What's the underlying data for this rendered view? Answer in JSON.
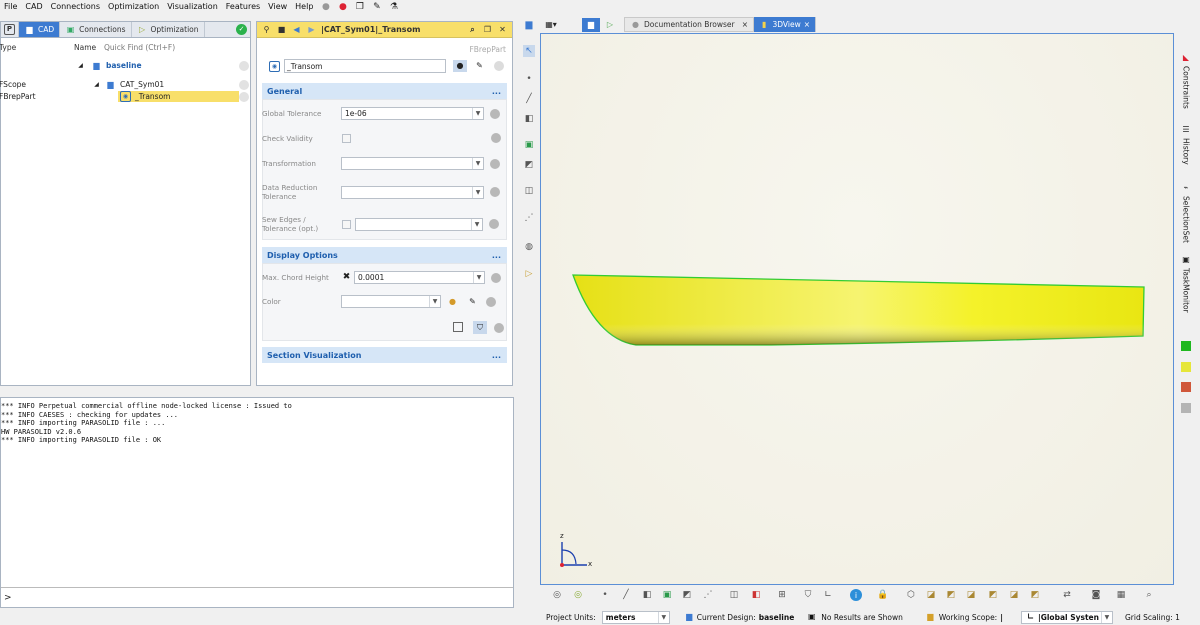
{
  "menubar": {
    "items": [
      "File",
      "CAD",
      "Connections",
      "Optimization",
      "Visualization",
      "Features",
      "View",
      "Help"
    ]
  },
  "left_tabs": {
    "p_label": "P",
    "cad": "CAD",
    "connections": "Connections",
    "optimization": "Optimization"
  },
  "tree": {
    "col_type": "Type",
    "col_name": "Name",
    "quick_find_placeholder": "Quick Find (Ctrl+F)",
    "rows": [
      {
        "type": "",
        "name": "baseline"
      },
      {
        "type": "FScope",
        "name": "CAT_Sym01"
      },
      {
        "type": "FBrepPart",
        "name": "_Transom"
      }
    ]
  },
  "props": {
    "title": "|CAT_Sym01|_Transom",
    "object_type": "FBrepPart",
    "name_value": "_Transom",
    "sections": {
      "general": "General",
      "display": "Display Options",
      "section_vis": "Section Visualization"
    },
    "collapse_glyph": "...",
    "labels": {
      "global_tolerance": "Global Tolerance",
      "check_validity": "Check Validity",
      "transformation": "Transformation",
      "data_reduction_1": "Data Reduction",
      "data_reduction_2": "Tolerance",
      "sew_edges_1": "Sew Edges /",
      "sew_edges_2": "Tolerance (opt.)",
      "max_chord": "Max. Chord Height",
      "color": "Color"
    },
    "values": {
      "global_tolerance": "1e-06",
      "transformation": "",
      "data_reduction": "",
      "sew_edges": "",
      "max_chord": "0.0001",
      "color": ""
    }
  },
  "console": {
    "lines": [
      "*** INFO Perpetual commercial offline node-locked license : Issued to",
      "*** INFO CAESES : checking for updates ...",
      "*** INFO importing PARASOLID file : ...",
      "HW PARASOLID v2.0.6",
      "*** INFO importing PARASOLID file : OK"
    ],
    "prompt": ">"
  },
  "viewer_tabs": {
    "doc_browser": "Documentation Browser",
    "view3d": "3DView",
    "close_glyph": "×"
  },
  "right_vtabs": [
    "Constraints",
    "History",
    "SelectionSet",
    "TaskMonitor"
  ],
  "status": {
    "project_units_label": "Project Units:",
    "project_units_value": "meters",
    "current_design_label": "Current Design:",
    "current_design_value": "baseline",
    "results": "No Results are Shown",
    "working_scope_label": "Working Scope:",
    "working_scope_value": "|",
    "global_system": "|Global Systen",
    "grid_scaling": "Grid Scaling: 1"
  },
  "axis_labels": {
    "z": "z",
    "x": "x"
  },
  "colors": {
    "accent": "#3d7bd1",
    "highlight": "#f8df6a",
    "hull_yellow": "#f2f01e",
    "hull_edge": "#33cc33",
    "viewport_bg": "#f3f1e6",
    "swatches": [
      "#1fb81f",
      "#e6e63a",
      "#d0573a",
      "#b4b4b4"
    ]
  }
}
